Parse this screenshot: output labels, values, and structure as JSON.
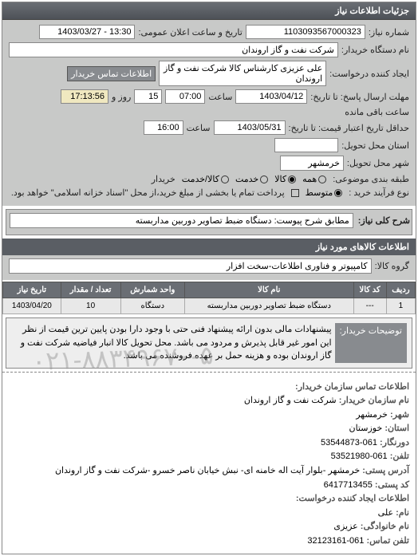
{
  "header": {
    "title": "جزئیات اطلاعات نیاز"
  },
  "form": {
    "request_number_label": "شماره نیاز:",
    "request_number": "1103093567000323",
    "public_datetime_label": "تاریخ و ساعت اعلان عمومی:",
    "public_datetime": "13:30 - 1403/03/27",
    "buyer_device_label": "نام دستگاه خریدار:",
    "buyer_device": "شرکت نفت و گاز اروندان",
    "creator_label": "ایجاد کننده درخواست:",
    "creator": "علی عزیزی کارشناس کالا شرکت نفت و گاز اروندان",
    "buyer_contact_label": "اطلاعات تماس خریدار",
    "deadline_label": "مهلت ارسال پاسخ: تا تاریخ:",
    "deadline_date": "1403/04/12",
    "time_label": "ساعت",
    "deadline_time": "07:00",
    "days_label": "روز و",
    "days_value": "15",
    "remaining_label": "ساعت باقی مانده",
    "remaining_time": "17:13:56",
    "validity_label": "حداقل تاریخ اعتبار قیمت: تا تاریخ:",
    "validity_date": "1403/05/31",
    "validity_time": "16:00",
    "delivery_province_label": "استان محل تحویل:",
    "delivery_province": "",
    "delivery_city_label": "شهر محل تحویل:",
    "delivery_city": "خرمشهر",
    "category_label": "طبقه بندی موضوعی:",
    "category_options": {
      "all": "همه",
      "goods": "کالا",
      "service": "خدمت",
      "goods_service": "کالا/خدمت"
    },
    "buyer_label": "خریدار",
    "purchase_type_label": "نوع فرآیند خرید :",
    "purchase_type_options": {
      "intermediate": "متوسط"
    },
    "purchase_note": "پرداخت تمام یا بخشی از مبلغ خرید،از محل \"اسناد خزانه اسلامی\" خواهد بود."
  },
  "description": {
    "label": "شرح کلی نیاز:",
    "value": "مطابق شرح پیوست: دستگاه ضبط تصاویر دوربین مداربسته"
  },
  "goods_section": {
    "title": "اطلاعات کالاهای مورد نیاز",
    "group_label": "گروه کالا:",
    "group_value": "کامپیوتر و فناوری اطلاعات-سخت افزار"
  },
  "table": {
    "headers": [
      "ردیف",
      "کد کالا",
      "نام کالا",
      "واحد شمارش",
      "تعداد / مقدار",
      "تاریخ نیاز"
    ],
    "rows": [
      {
        "index": "1",
        "code": "---",
        "name": "دستگاه ضبط تصاویر دوربین مداربسته",
        "unit": "دستگاه",
        "qty": "10",
        "date": "1403/04/20"
      }
    ]
  },
  "notes": {
    "label": "توضیحات خریدار:",
    "text": "پیشنهادات مالی بدون ارائه پیشنهاد فنی حتی با وجود دارا بودن پایین ترین قیمت از نظر این امور غیر قابل پذیرش و مردود می باشد. محل تحویل کالا انبار فیاضیه شرکت نفت و گاز اروندان بوده و هزینه حمل بر عهده فروشنده می باشد."
  },
  "contact": {
    "section_title": "اطلاعات تماس سازمان خریدار:",
    "org_label": "نام سازمان خریدار:",
    "org": "شرکت نفت و گاز اروندان",
    "city_label": "شهر:",
    "city": "خرمشهر",
    "province_label": "استان:",
    "province": "خوزستان",
    "fax_label": "دورنگار:",
    "fax": "061-53544873",
    "phone_label": "تلفن:",
    "phone": "061-53521980",
    "address_label": "آدرس پستی:",
    "address": "خرمشهر -بلوار آیت اله خامنه ای- نبش خیابان ناصر خسرو -شرکت نفت و گاز اروندان",
    "postal_label": "کد پستی:",
    "postal": "6417713455",
    "creator_section": "اطلاعات ایجاد کننده درخواست:",
    "name_label": "نام:",
    "name": "علی",
    "family_label": "نام خانوادگی:",
    "family": "عزیزی",
    "contact_phone_label": "تلفن تماس:",
    "contact_phone": "061-32123161"
  },
  "watermark": "۰۲۱-۸۸۳۴۹۶۷۰-۵"
}
